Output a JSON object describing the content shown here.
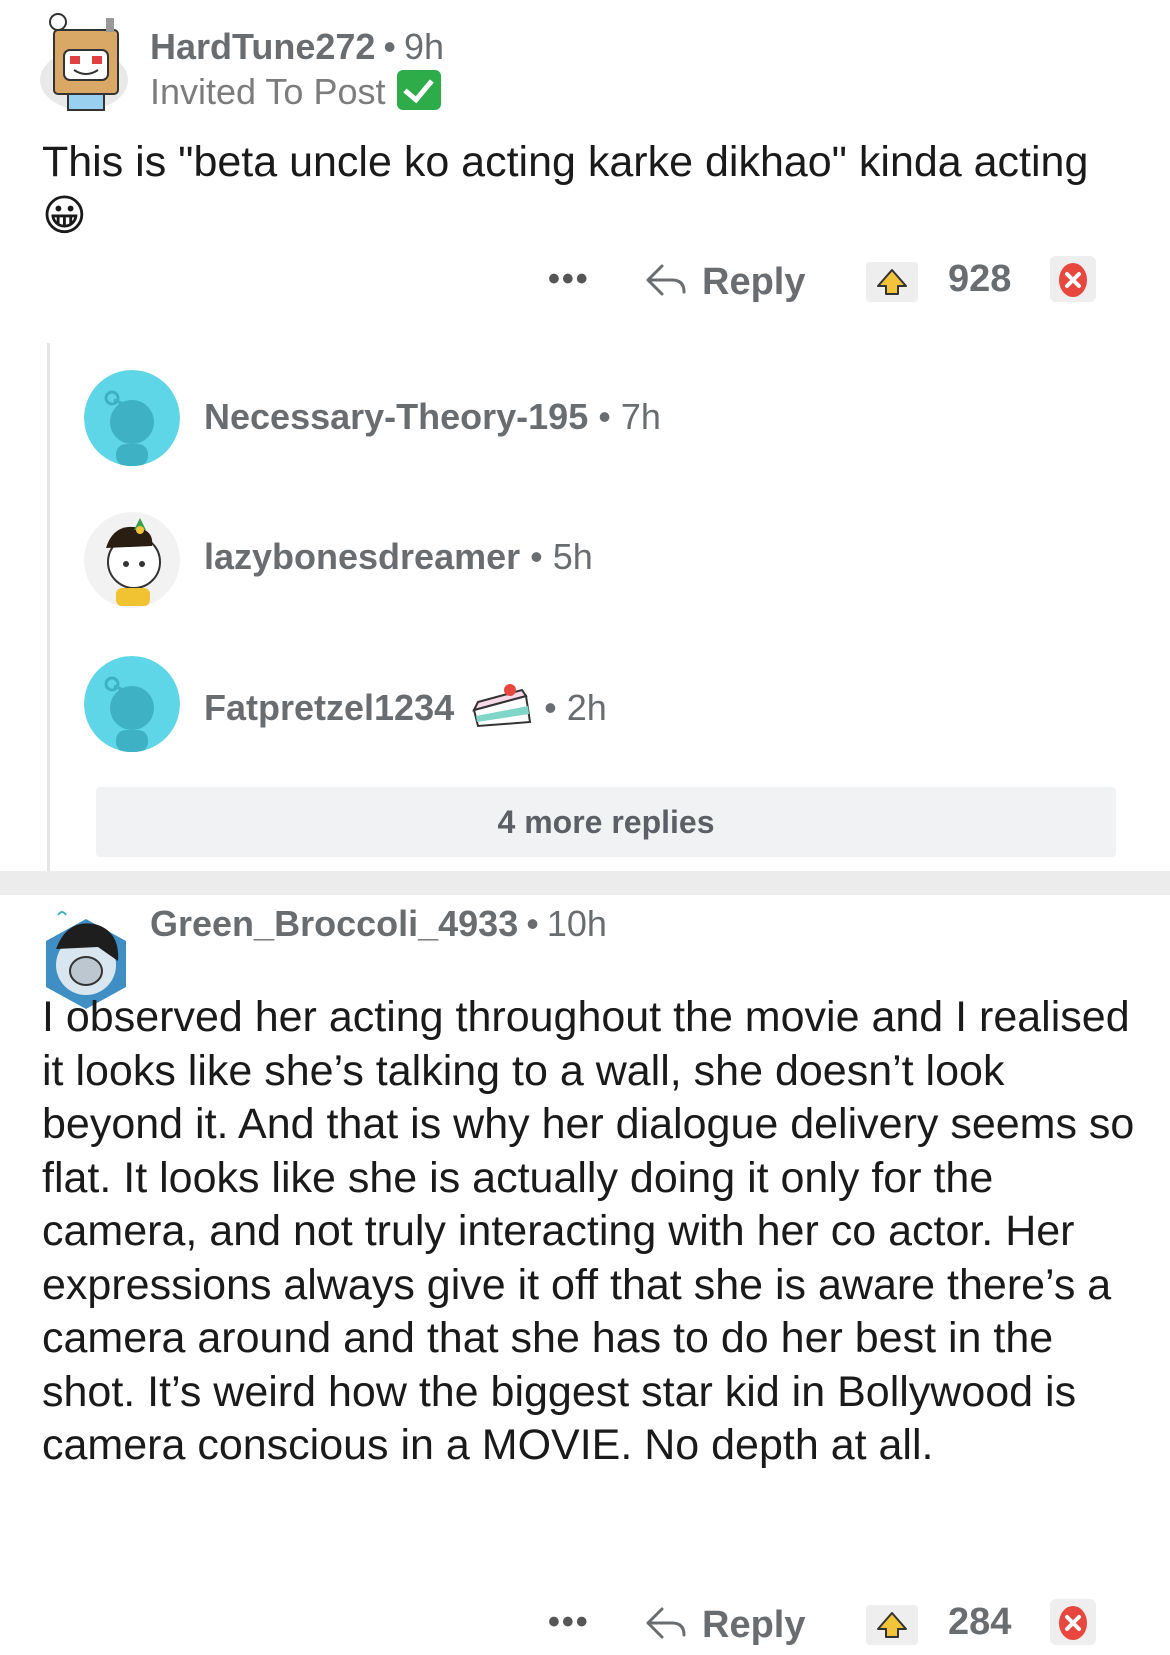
{
  "comments": [
    {
      "username": "HardTune272",
      "age": "9h",
      "flair": "Invited To Post",
      "body": "This is \"beta uncle ko acting karke dikhao\" kinda acting 😀",
      "actions": {
        "more": "•••",
        "reply": "Reply",
        "score": "928"
      }
    },
    {
      "username": "Green_Broccoli_4933",
      "age": "10h",
      "body": "I observed her acting throughout the movie and I realised it looks like she’s talking to a wall, she doesn’t look beyond it. And that is why her dialogue delivery seems so flat. It looks like she is actually doing it only for the camera, and not truly interacting with her co actor. Her expressions always give it off that she is aware there’s a camera around and that she has to do her best in the shot. It’s weird how the biggest star kid in Bollywood is camera conscious in a MOVIE. No depth at all.",
      "actions": {
        "more": "•••",
        "reply": "Reply",
        "score": "284"
      }
    }
  ],
  "replies": [
    {
      "username": "Necessary-Theory-195",
      "age": "7h"
    },
    {
      "username": "lazybonesdreamer",
      "age": "5h"
    },
    {
      "username": "Fatpretzel1234",
      "age": "2h"
    }
  ],
  "more_replies": "4 more replies",
  "colors": {
    "accent_green": "#2eac4a",
    "snoo_teal": "#5ed6e8",
    "downvote_red": "#e8473f"
  },
  "icons": [
    "reply-arrow-icon",
    "upvote-icon",
    "downvote-icon",
    "checkmark-icon",
    "cake-icon"
  ]
}
